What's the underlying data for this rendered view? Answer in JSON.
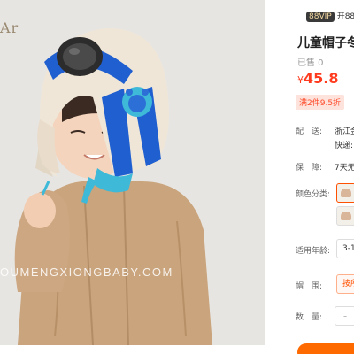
{
  "photo": {
    "brand_mark": "Ar",
    "watermark": "OUMENGXIONGBABY.COM",
    "alt": "儿童帽子"
  },
  "product": {
    "vip_badge": "88VIP",
    "vip_text": "开88V",
    "title": "儿童帽子冬",
    "sold": "已售 0",
    "currency": "¥",
    "price": "45.8",
    "promo": "满2件9.5折"
  },
  "shipping": {
    "label": "配　送:",
    "from": "浙江金",
    "speed": "快递:"
  },
  "guarantee": {
    "label": "保　障:",
    "value": "7天无"
  },
  "color": {
    "label": "颜色分类:"
  },
  "age": {
    "label": "适用年龄:",
    "value": "3-1"
  },
  "hat_size": {
    "label": "帽　围:",
    "value": "按所"
  },
  "quantity": {
    "label": "数　量:",
    "minus": "-"
  },
  "colors": {
    "accent": "#ff5000",
    "price": "#ff3b1f"
  }
}
